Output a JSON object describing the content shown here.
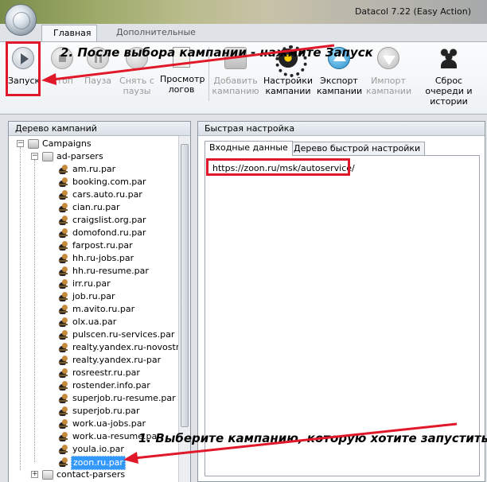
{
  "window": {
    "title": "Datacol 7.22 (Easy Action)"
  },
  "ribbon_tabs": [
    {
      "label": "Главная",
      "active": true
    },
    {
      "label": "Дополнительные",
      "active": false
    }
  ],
  "ribbon_buttons": [
    {
      "label": "Запуск",
      "icon": "play-icon",
      "enabled": true
    },
    {
      "label": "Стоп",
      "icon": "stop-icon",
      "enabled": false
    },
    {
      "label": "Пауза",
      "icon": "pause-icon",
      "enabled": false
    },
    {
      "label": "Снять с паузы",
      "icon": "unpause-icon",
      "enabled": false
    },
    {
      "label": "Просмотр логов",
      "icon": "log-icon",
      "enabled": true
    },
    {
      "label": "Добавить кампанию",
      "icon": "add-campaign-icon",
      "enabled": false
    },
    {
      "label": "Настройки кампании",
      "icon": "gear-icon",
      "enabled": true
    },
    {
      "label": "Экспорт кампании",
      "icon": "export-icon",
      "enabled": true
    },
    {
      "label": "Импорт кампании",
      "icon": "import-icon",
      "enabled": false
    },
    {
      "label": "Сброс очереди и истории",
      "icon": "reset-queue-icon",
      "enabled": true
    }
  ],
  "annotations": {
    "step1": "1. Выберите кампанию, которую хотите запустить",
    "step2": "2. После выбора кампании - нажмите Запуск"
  },
  "left_panel": {
    "title": "Дерево кампаний",
    "root": "Campaigns",
    "group": "ad-parsers",
    "items": [
      "am.ru.par",
      "booking.com.par",
      "cars.auto.ru.par",
      "cian.ru.par",
      "craigslist.org.par",
      "domofond.ru.par",
      "farpost.ru.par",
      "hh.ru-jobs.par",
      "hh.ru-resume.par",
      "irr.ru.par",
      "job.ru.par",
      "m.avito.ru.par",
      "olx.ua.par",
      "pulscen.ru-services.par",
      "realty.yandex.ru-novostro",
      "realty.yandex.ru-par",
      "rosreestr.ru.par",
      "rostender.info.par",
      "superjob.ru-resume.par",
      "superjob.ru.par",
      "work.ua-jobs.par",
      "work.ua-resume.par",
      "youla.io.par",
      "zoon.ru.par"
    ],
    "selected": "zoon.ru.par",
    "next_group": "contact-parsers"
  },
  "right_panel": {
    "title": "Быстрая настройка",
    "tabs": [
      {
        "label": "Входные данные",
        "active": true
      },
      {
        "label": "Дерево быстрой настройки",
        "active": false
      }
    ],
    "input_value": "https://zoon.ru/msk/autoservice/"
  },
  "colors": {
    "highlight": "#e0182a",
    "selection": "#3399ff"
  }
}
